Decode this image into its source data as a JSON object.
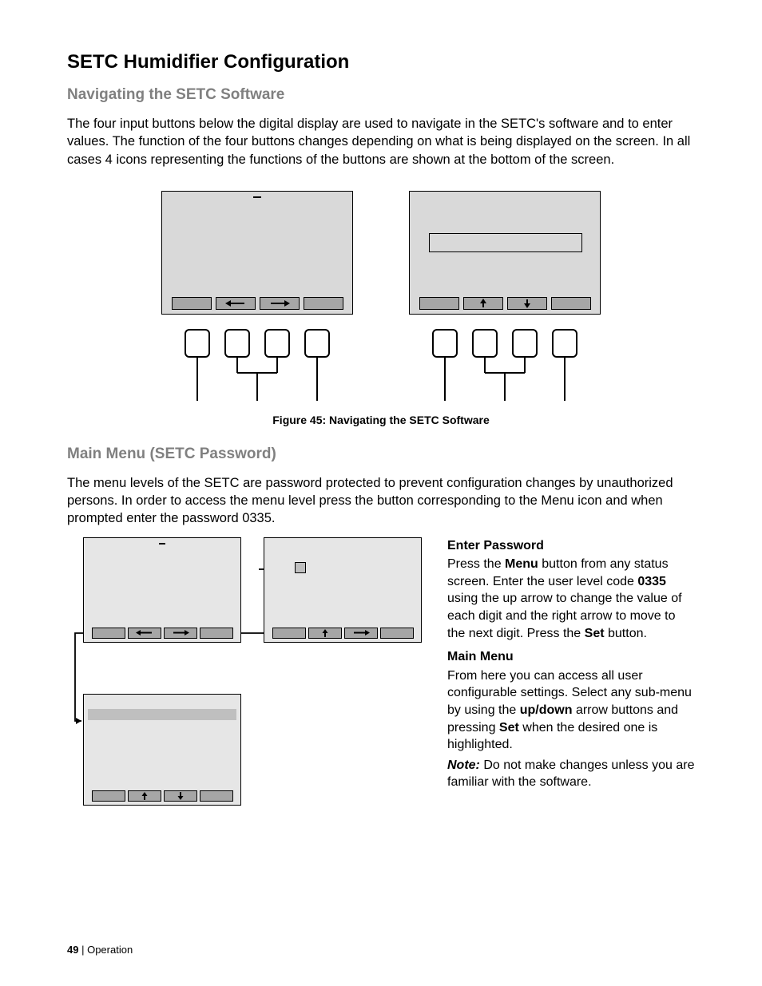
{
  "title": "SETC Humidifier Configuration",
  "section1": {
    "heading": "Navigating the SETC Software",
    "para": "The four input buttons below the digital display are used to navigate in the SETC's software and to enter values.  The function of the four buttons changes depending on what is being displayed on the screen.  In all cases 4 icons representing the functions of the buttons are shown at the bottom of the screen."
  },
  "figure_caption": "Figure 45: Navigating the SETC Software",
  "section2": {
    "heading": "Main Menu  (SETC Password)",
    "para": "The menu levels of the SETC are password protected to prevent configuration changes by unauthorized persons.  In order to access the menu level press the button corresponding to the Menu icon and when prompted enter the password 0335."
  },
  "steps": {
    "enter_password": {
      "heading": "Enter Password",
      "text_pre": "Press the ",
      "menu": "Menu",
      "text_mid1": " button from any status screen. Enter the user level code ",
      "code": "0335",
      "text_mid2": " using the up arrow to change the value of each digit and the right arrow to move to the next digit.  Press the ",
      "set": "Set",
      "text_end": " button."
    },
    "main_menu": {
      "heading": "Main Menu",
      "text_pre": "From here you can access all user configurable settings.  Select any sub-menu by using the ",
      "updown": "up/down",
      "text_mid": " arrow buttons and pressing ",
      "set": "Set",
      "text_end": " when the desired one is highlighted.",
      "note_label": "Note:",
      "note_text": " Do not make changes unless you are familiar with the software."
    }
  },
  "footer": {
    "page": "49",
    "sep": " | ",
    "section": "Operation"
  },
  "icons": {
    "left": "←",
    "right": "→",
    "up": "↑",
    "down": "↓"
  }
}
